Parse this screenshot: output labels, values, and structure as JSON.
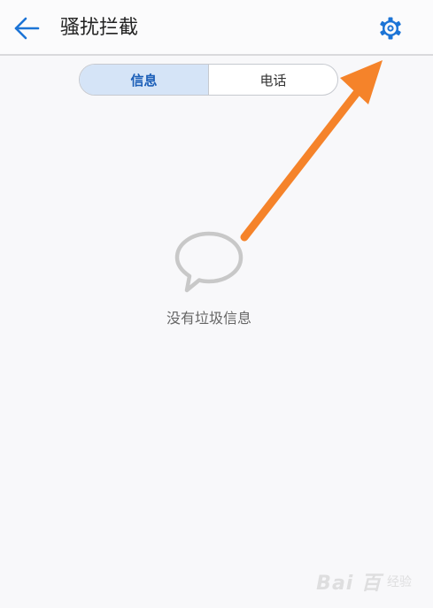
{
  "header": {
    "back_icon": "arrow-left-icon",
    "title": "骚扰拦截",
    "settings_icon": "gear-icon"
  },
  "tabs": [
    {
      "label": "信息",
      "active": true
    },
    {
      "label": "电话",
      "active": false
    }
  ],
  "empty_state": {
    "icon": "chat-bubble-icon",
    "text": "没有垃圾信息"
  },
  "watermark": {
    "logo": "Bai 百",
    "text": "经验"
  },
  "colors": {
    "accent": "#1c74d6",
    "tab_active_bg": "#d5e4f7",
    "arrow": "#f5832a"
  }
}
